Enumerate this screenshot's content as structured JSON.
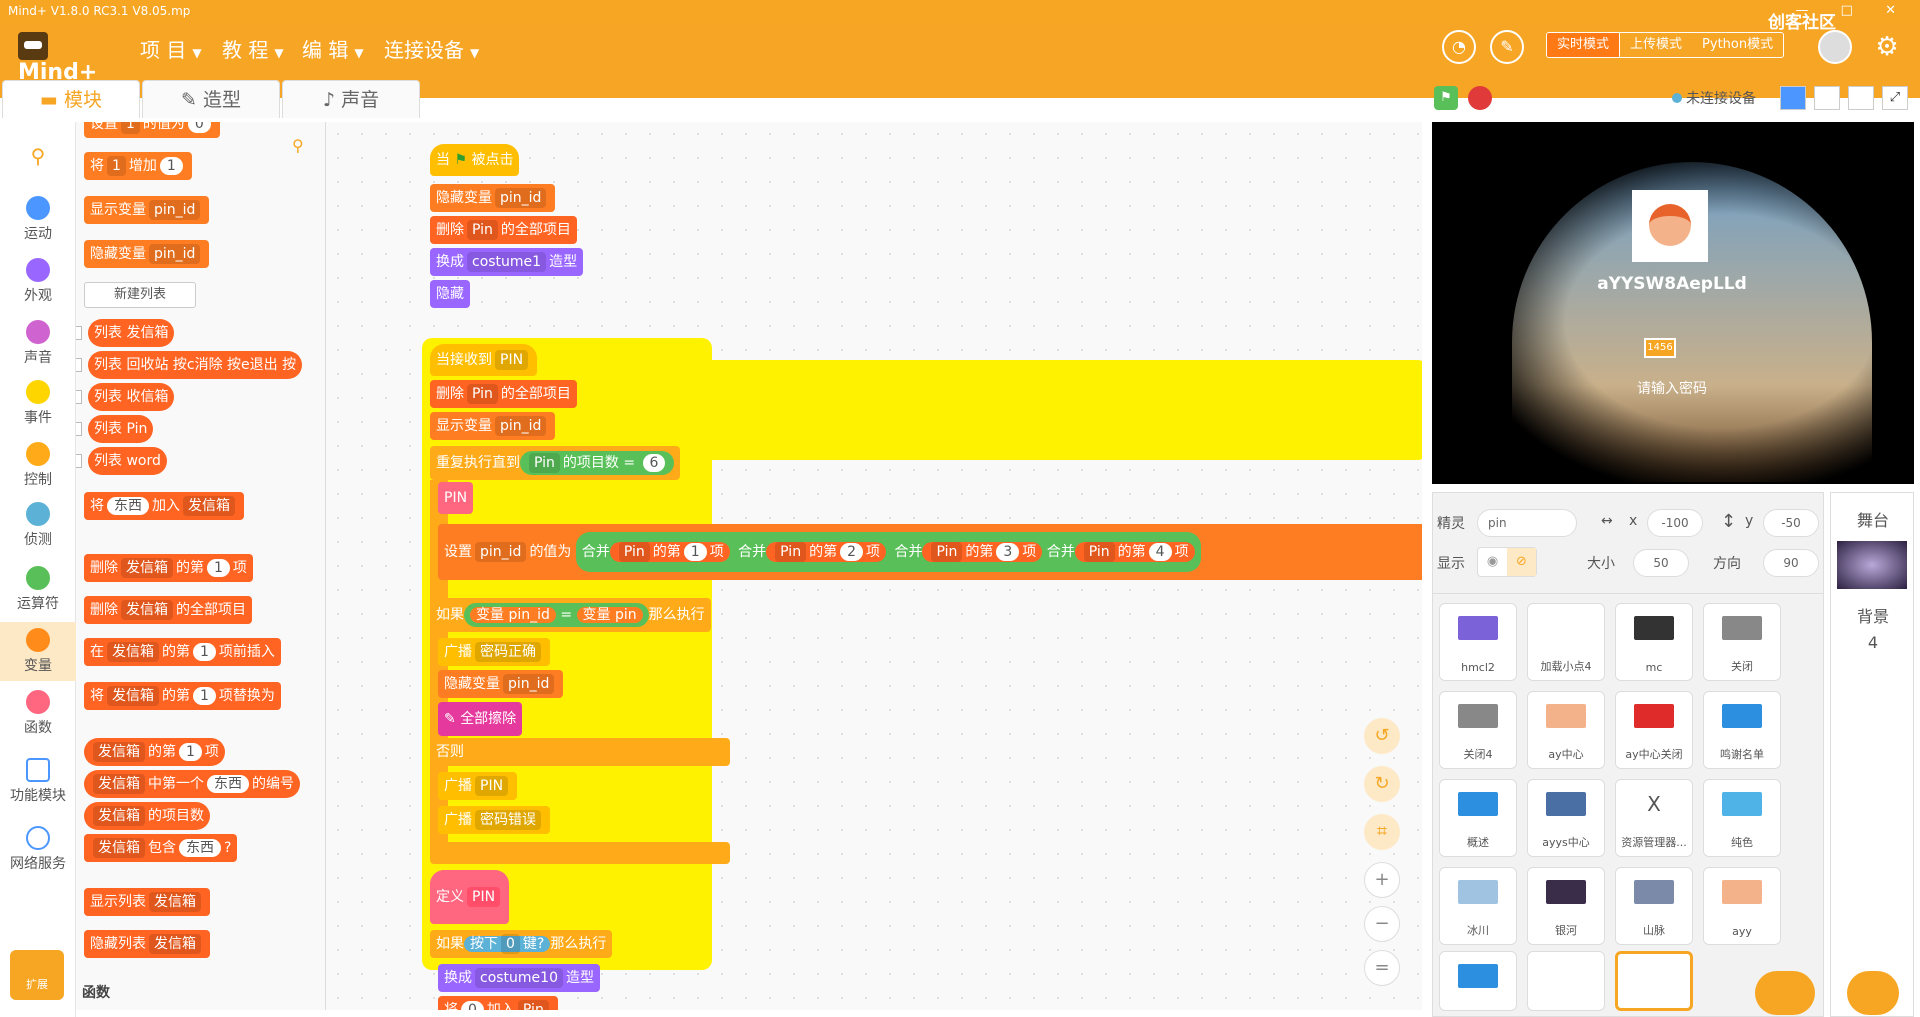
{
  "window": {
    "title": "Mind+ V1.8.0 RC3.1    V8.05.mp",
    "win_controls": "— □ ✕"
  },
  "menu": {
    "items": [
      "项 目",
      "教 程",
      "编 辑",
      "连接设备"
    ]
  },
  "toolbar": {
    "modes": [
      "实时模式",
      "上传模式",
      "Python模式"
    ],
    "watermark": "创客社区"
  },
  "tabs": [
    "模块",
    "造型",
    "声音"
  ],
  "categories": [
    {
      "label": "运动",
      "color": "#4c97ff"
    },
    {
      "label": "外观",
      "color": "#9966ff"
    },
    {
      "label": "声音",
      "color": "#cf63cf"
    },
    {
      "label": "事件",
      "color": "#ffd500"
    },
    {
      "label": "控制",
      "color": "#ffab19"
    },
    {
      "label": "侦测",
      "color": "#5cb1d6"
    },
    {
      "label": "运算符",
      "color": "#59c059"
    },
    {
      "label": "变量",
      "color": "#ff8c1a"
    },
    {
      "label": "函数",
      "color": "#ff6680"
    },
    {
      "label": "功能模块",
      "color": ""
    },
    {
      "label": "网络服务",
      "color": ""
    }
  ],
  "ext_label": "扩展",
  "palette": {
    "b_set": "设置",
    "b_set_to": "的值为",
    "one": "1",
    "zero": "0",
    "b_change": "将",
    "b_change_by": "增加",
    "show_var": "显示变量",
    "hide_var": "隐藏变量",
    "var_pin_id": "pin_id",
    "new_list": "新建列表",
    "lists": [
      "列表 发信箱",
      "列表 回收站 按c消除 按e退出 按",
      "列表 收信箱",
      "列表 Pin",
      "列表 word"
    ],
    "add": "将",
    "add_thing": "东西",
    "add_to": "加入",
    "inbox": "发信箱",
    "delete": "删除",
    "item_of": "的第",
    "item": "项",
    "delete_all": "的全部项目",
    "insert_at": "在",
    "insert_before": "项前插入",
    "replace": "将",
    "replace_with": "项替换为",
    "item_num": "中第一个",
    "item_num2": "的编号",
    "length": "的项目数",
    "contains": "包含",
    "q": "?",
    "show_list": "显示列表",
    "hide_list": "隐藏列表",
    "section_fn": "函数"
  },
  "script1": {
    "hat": "当",
    "hat2": "被点击",
    "hide_var": "隐藏变量",
    "var": "pin_id",
    "del": "删除",
    "list_pin": "Pin",
    "del_all": "的全部项目",
    "switch": "换成",
    "costume1": "costume1",
    "costume_word": "造型",
    "hide": "隐藏"
  },
  "script2": {
    "recv": "当接收到",
    "msg": "PIN",
    "del": "删除",
    "list_pin": "Pin",
    "del_all": "的全部项目",
    "show_var": "显示变量",
    "var": "pin_id",
    "repeat": "重复执行直到",
    "length": "的项目数",
    "eq": "=",
    "six": "6",
    "pin_block": "PIN",
    "set": "设置",
    "set_to": "的值为",
    "join": "合并",
    "item_of": "的第",
    "item": "项",
    "n1": "1",
    "n2": "2",
    "n3": "3",
    "n4": "4",
    "if": "如果",
    "var_pin_id": "变量 pin_id",
    "var_pin": "变量 pin",
    "then": "那么执行",
    "broadcast": "广播",
    "ok": "密码正确",
    "hide_var": "隐藏变量",
    "erase": "全部擦除",
    "else": "否则",
    "wrong": "密码错误"
  },
  "script3": {
    "define": "定义",
    "name": "PIN",
    "if": "如果",
    "press": "按下",
    "key": "0",
    "key_q": "键?",
    "then": "那么执行",
    "switch": "换成",
    "costume10": "costume10",
    "costume_word": "造型",
    "add": "将",
    "zero": "0",
    "add_to": "加入",
    "list": "Pin"
  },
  "stage": {
    "device": "未连接设备",
    "name_text": "aYYSW8AepLLd",
    "pin_box": "1456",
    "prompt": "请输入密码"
  },
  "sprite": {
    "label": "精灵",
    "name": "pin",
    "x_label": "x",
    "x": "-100",
    "y_label": "y",
    "y": "-50",
    "show_label": "显示",
    "size_label": "大小",
    "size": "50",
    "dir_label": "方向",
    "dir": "90",
    "thumbs": [
      {
        "label": "hmcl2",
        "color": "#7b62d9"
      },
      {
        "label": "加载小点4",
        "color": "#ffffff"
      },
      {
        "label": "mc",
        "color": "#333333"
      },
      {
        "label": "关闭",
        "color": "#888888"
      },
      {
        "label": "关闭4",
        "color": "#888888"
      },
      {
        "label": "ay中心",
        "color": "#f3b28a"
      },
      {
        "label": "ay中心关闭",
        "color": "#e02b2b"
      },
      {
        "label": "鸣谢名单",
        "color": "#2d8fe0"
      },
      {
        "label": "概述",
        "color": "#2d8fe0"
      },
      {
        "label": "ayys中心",
        "color": "#4a6fa5"
      },
      {
        "label": "资源管理器...",
        "color": ""
      },
      {
        "label": "纯色",
        "color": "#4fb3e8"
      },
      {
        "label": "冰川",
        "color": "#9fc3e0"
      },
      {
        "label": "银河",
        "color": "#3a2d4a"
      },
      {
        "label": "山脉",
        "color": "#7a8aa8"
      },
      {
        "label": "ayy",
        "color": "#f3b28a"
      }
    ],
    "x_glyph": "X"
  },
  "backdrop": {
    "title": "舞台",
    "label": "背景",
    "count": "4"
  }
}
